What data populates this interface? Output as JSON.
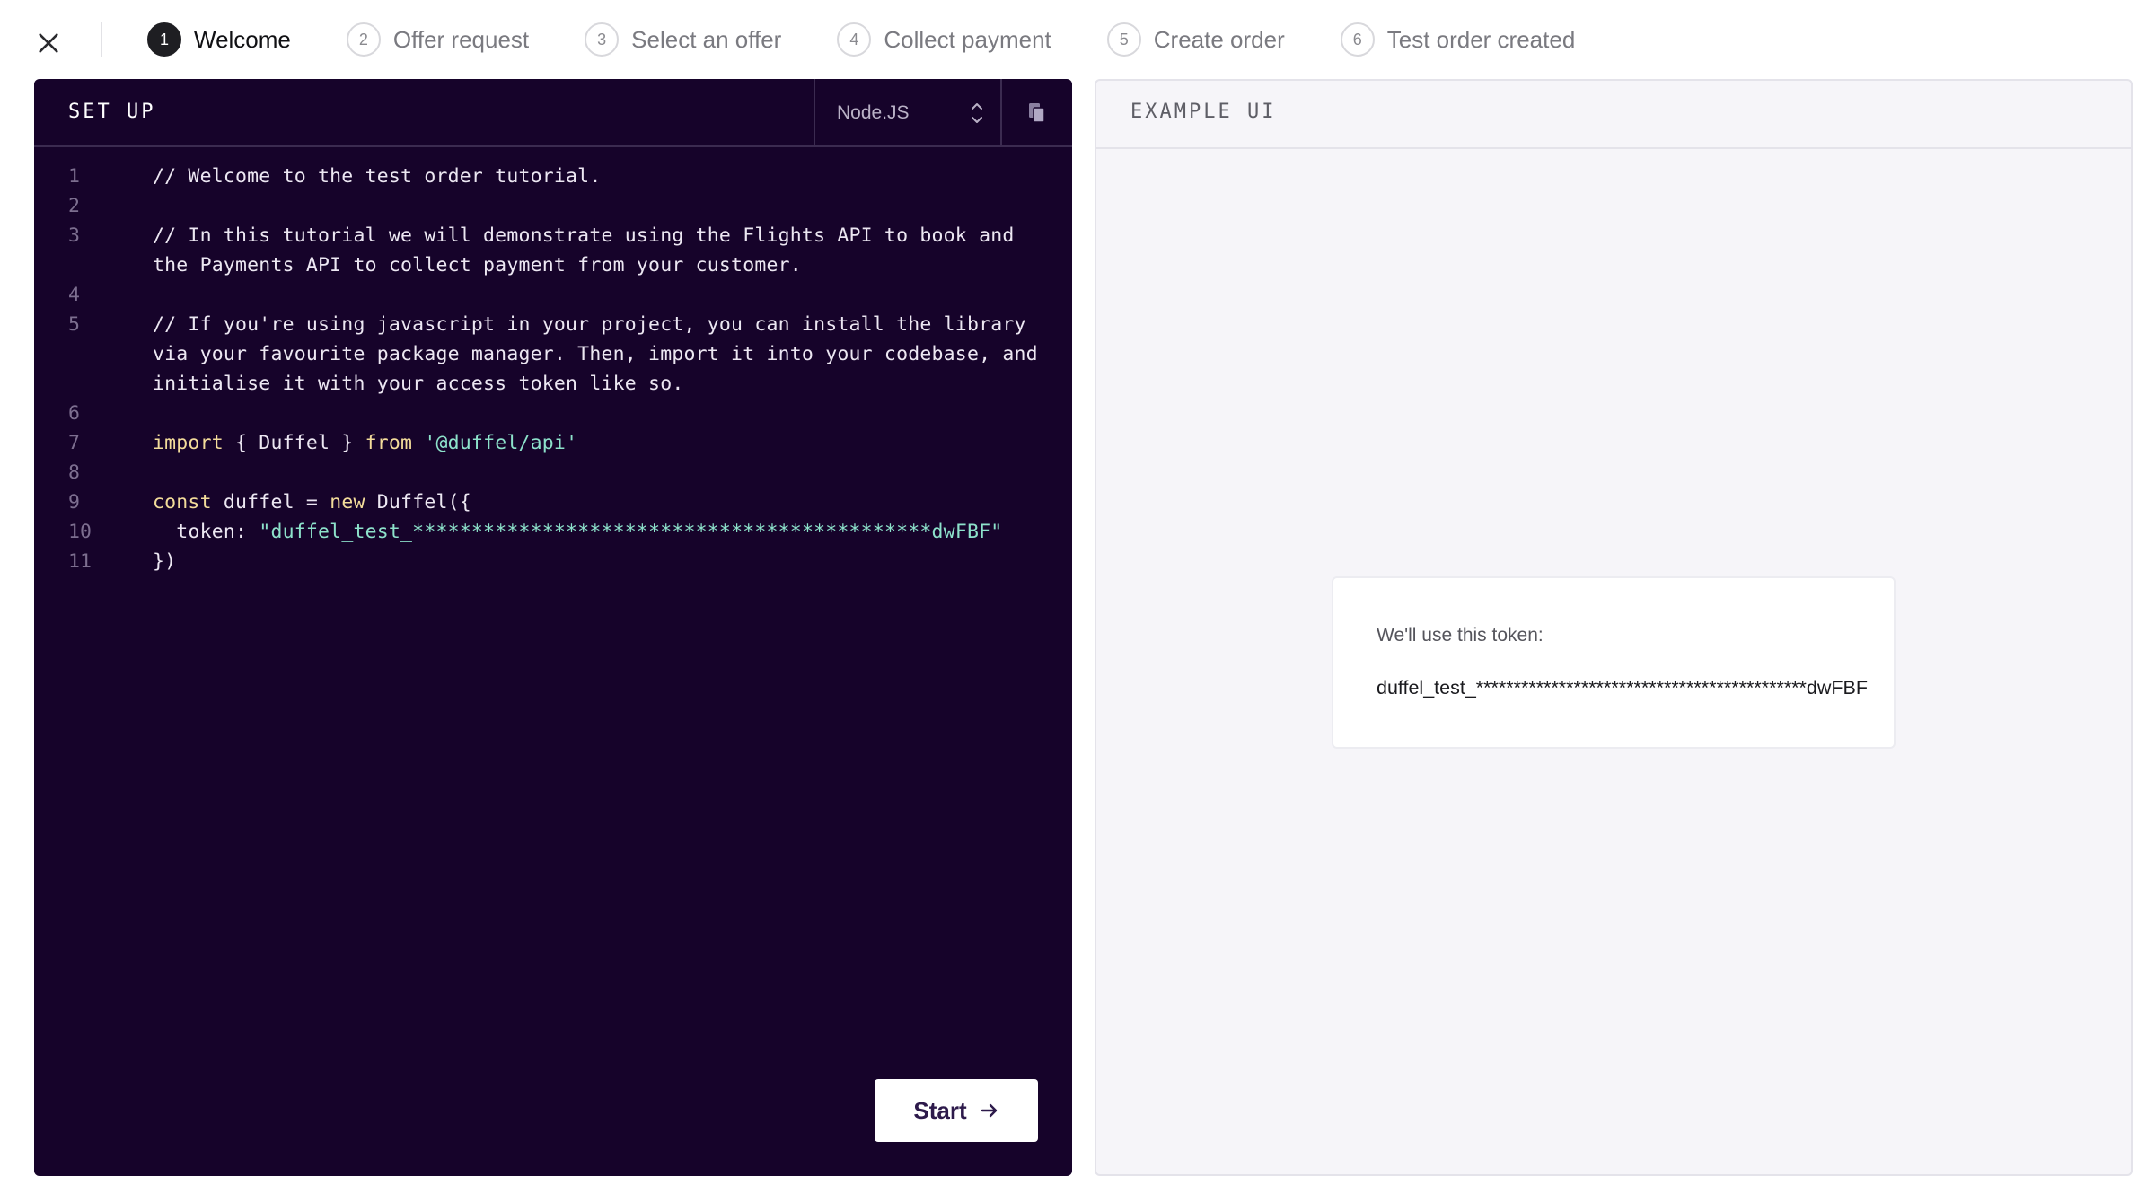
{
  "steps": [
    {
      "num": "1",
      "label": "Welcome"
    },
    {
      "num": "2",
      "label": "Offer request"
    },
    {
      "num": "3",
      "label": "Select an offer"
    },
    {
      "num": "4",
      "label": "Collect payment"
    },
    {
      "num": "5",
      "label": "Create order"
    },
    {
      "num": "6",
      "label": "Test order created"
    }
  ],
  "active_step": "1",
  "code_panel": {
    "title": "SET UP",
    "language": "Node.JS",
    "lines": [
      {
        "n": "1",
        "parts": [
          {
            "t": "comment",
            "v": "// Welcome to the test order tutorial."
          }
        ]
      },
      {
        "n": "2",
        "parts": []
      },
      {
        "n": "3",
        "parts": [
          {
            "t": "comment",
            "v": "// In this tutorial we will demonstrate using the Flights API to book and the Payments API to collect payment from your customer."
          }
        ]
      },
      {
        "n": "4",
        "parts": []
      },
      {
        "n": "5",
        "parts": [
          {
            "t": "comment",
            "v": "// If you're using javascript in your project, you can install the library via your favourite package manager. Then, import it into your codebase, and initialise it with your access token like so."
          }
        ]
      },
      {
        "n": "6",
        "parts": []
      },
      {
        "n": "7",
        "parts": [
          {
            "t": "kw",
            "v": "import"
          },
          {
            "t": "plain",
            "v": " { Duffel } "
          },
          {
            "t": "kw",
            "v": "from"
          },
          {
            "t": "plain",
            "v": " "
          },
          {
            "t": "str",
            "v": "'@duffel/api'"
          }
        ]
      },
      {
        "n": "8",
        "parts": []
      },
      {
        "n": "9",
        "parts": [
          {
            "t": "kw",
            "v": "const"
          },
          {
            "t": "plain",
            "v": " duffel = "
          },
          {
            "t": "kw",
            "v": "new"
          },
          {
            "t": "plain",
            "v": " Duffel({"
          }
        ]
      },
      {
        "n": "10",
        "parts": [
          {
            "t": "plain",
            "v": "  token: "
          },
          {
            "t": "str",
            "v": "\"duffel_test_********************************************dwFBF\""
          }
        ]
      },
      {
        "n": "11",
        "parts": [
          {
            "t": "plain",
            "v": "})"
          }
        ]
      }
    ],
    "start_label": "Start"
  },
  "example_panel": {
    "title": "EXAMPLE UI",
    "token_caption": "We'll use this token:",
    "token_value": "duffel_test_********************************************dwFBF"
  },
  "colors": {
    "code_bg": "#16032a",
    "keyword": "#f3dc9a",
    "string": "#8de2cb",
    "accent_text": "#2d1a4b"
  },
  "icons": {
    "close": "close-icon",
    "select": "chevron-up-down-icon",
    "copy": "copy-icon",
    "start": "arrow-right-icon"
  }
}
